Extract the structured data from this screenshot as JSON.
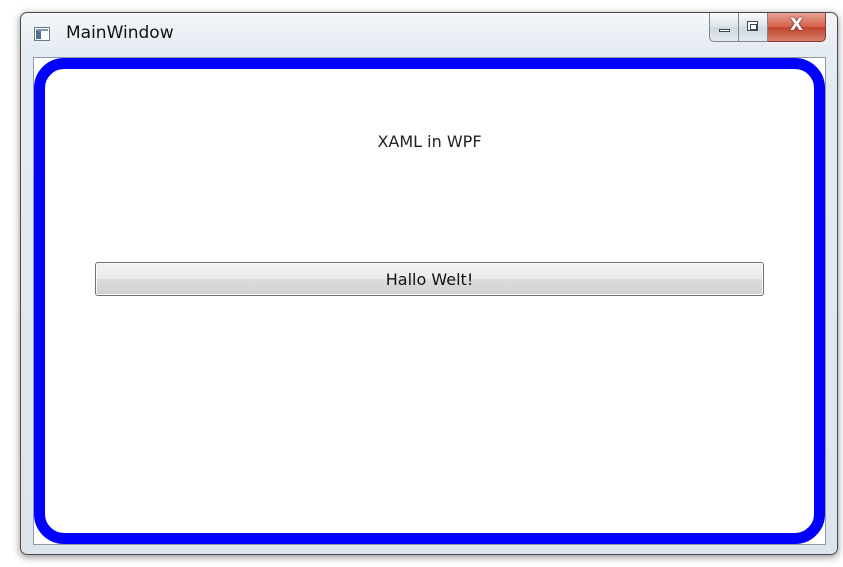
{
  "window": {
    "title": "MainWindow",
    "app_icon": "window-app-icon",
    "caption_buttons": {
      "minimize_icon": "minimize-icon",
      "maximize_icon": "maximize-icon",
      "close_label": "X"
    }
  },
  "content": {
    "heading": "XAML in WPF",
    "button_label": "Hallo Welt!",
    "border_color": "#0000FF"
  }
}
